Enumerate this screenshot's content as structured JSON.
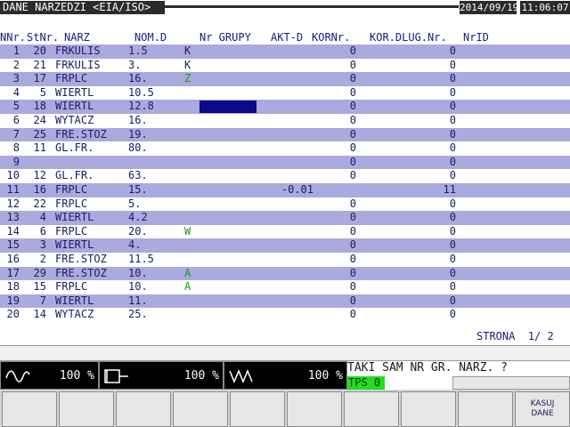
{
  "header": {
    "title": "DANE NARZEDZI <EIA/ISO>",
    "date": "2014/09/19",
    "time": "11:06:07"
  },
  "columns": [
    "NNr.",
    "StNr.",
    "NARZ",
    "NOM.D",
    "Nr GRUPY",
    "AKT-D",
    "KORNr.",
    "KOR.DLUG.Nr.",
    "NrID"
  ],
  "rows": [
    {
      "nnr": "1",
      "stnr": "20",
      "narz": "FRKULIS",
      "nomd": "1.5",
      "grupa": "K",
      "aktd": "",
      "kornr": "0",
      "kordlug": "0"
    },
    {
      "nnr": "2",
      "stnr": "21",
      "narz": "FRKULIS",
      "nomd": "3.",
      "grupa": "K",
      "aktd": "",
      "kornr": "0",
      "kordlug": "0"
    },
    {
      "nnr": "3",
      "stnr": "17",
      "narz": "FRPLC",
      "nomd": "16.",
      "grupa": "Z",
      "aktd": "",
      "kornr": "0",
      "kordlug": "0"
    },
    {
      "nnr": "4",
      "stnr": "5",
      "narz": "WIERTL",
      "nomd": "10.5",
      "grupa": "",
      "aktd": "",
      "kornr": "0",
      "kordlug": "0"
    },
    {
      "nnr": "5",
      "stnr": "18",
      "narz": "WIERTL",
      "nomd": "12.8",
      "grupa": "",
      "aktd": "",
      "kornr": "0",
      "kordlug": "0"
    },
    {
      "nnr": "6",
      "stnr": "24",
      "narz": "WYTACZ",
      "nomd": "16.",
      "grupa": "",
      "aktd": "",
      "kornr": "0",
      "kordlug": "0"
    },
    {
      "nnr": "7",
      "stnr": "25",
      "narz": "FRE.STOZ",
      "nomd": "19.",
      "grupa": "",
      "aktd": "",
      "kornr": "0",
      "kordlug": "0"
    },
    {
      "nnr": "8",
      "stnr": "11",
      "narz": "GL.FR.",
      "nomd": "80.",
      "grupa": "",
      "aktd": "",
      "kornr": "0",
      "kordlug": "0"
    },
    {
      "nnr": "9",
      "stnr": "",
      "narz": "",
      "nomd": "",
      "grupa": "",
      "aktd": "",
      "kornr": "0",
      "kordlug": "0"
    },
    {
      "nnr": "10",
      "stnr": "12",
      "narz": "GL.FR.",
      "nomd": "63.",
      "grupa": "",
      "aktd": "",
      "kornr": "0",
      "kordlug": "0"
    },
    {
      "nnr": "11",
      "stnr": "16",
      "narz": "FRPLC",
      "nomd": "15.",
      "grupa": "",
      "aktd": "-0.01",
      "kornr": "",
      "kordlug": "11"
    },
    {
      "nnr": "12",
      "stnr": "22",
      "narz": "FRPLC",
      "nomd": "5.",
      "grupa": "",
      "aktd": "",
      "kornr": "0",
      "kordlug": "0"
    },
    {
      "nnr": "13",
      "stnr": "4",
      "narz": "WIERTL",
      "nomd": "4.2",
      "grupa": "",
      "aktd": "",
      "kornr": "0",
      "kordlug": "0"
    },
    {
      "nnr": "14",
      "stnr": "6",
      "narz": "FRPLC",
      "nomd": "20.",
      "grupa": "W",
      "aktd": "",
      "kornr": "0",
      "kordlug": "0"
    },
    {
      "nnr": "15",
      "stnr": "3",
      "narz": "WIERTL",
      "nomd": "4.",
      "grupa": "",
      "aktd": "",
      "kornr": "0",
      "kordlug": "0"
    },
    {
      "nnr": "16",
      "stnr": "2",
      "narz": "FRE.STOZ",
      "nomd": "11.5",
      "grupa": "",
      "aktd": "",
      "kornr": "0",
      "kordlug": "0"
    },
    {
      "nnr": "17",
      "stnr": "29",
      "narz": "FRE.STOZ",
      "nomd": "10.",
      "grupa": "A",
      "aktd": "",
      "kornr": "0",
      "kordlug": "0"
    },
    {
      "nnr": "18",
      "stnr": "15",
      "narz": "FRPLC",
      "nomd": "10.",
      "grupa": "A",
      "aktd": "",
      "kornr": "0",
      "kordlug": "0"
    },
    {
      "nnr": "19",
      "stnr": "7",
      "narz": "WIERTL",
      "nomd": "11.",
      "grupa": "",
      "aktd": "",
      "kornr": "0",
      "kordlug": "0"
    },
    {
      "nnr": "20",
      "stnr": "14",
      "narz": "WYTACZ",
      "nomd": "25.",
      "grupa": "",
      "aktd": "",
      "kornr": "0",
      "kordlug": "0"
    }
  ],
  "pager": {
    "label": "STRONA",
    "value": "1/ 2"
  },
  "overrides": [
    {
      "icon": "spindle-wave-icon",
      "value": "100 %"
    },
    {
      "icon": "tool-spindle-icon",
      "value": "100 %"
    },
    {
      "icon": "rapid-feed-icon",
      "value": "100 %"
    }
  ],
  "message": {
    "text": "TAKI SAM NR GR. NARZ. ?",
    "tps": "TPS 0"
  },
  "softkeys": [
    "",
    "",
    "",
    "",
    "",
    "",
    "",
    "",
    "",
    "KASUJ\nDANE"
  ],
  "colors": {
    "row_alt": "#aaaade",
    "title_bg": "#2b2b2b",
    "tps_bg": "#22dd22",
    "selection": "#0a0a8a"
  }
}
